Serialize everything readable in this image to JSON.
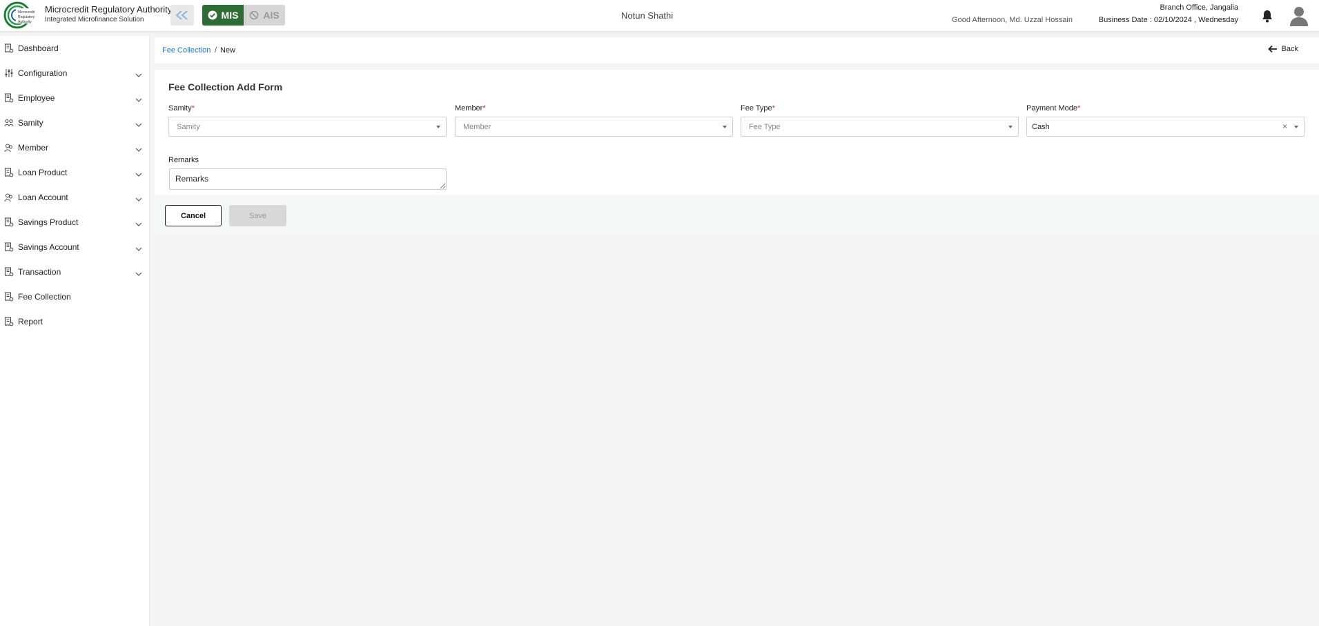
{
  "header": {
    "brand_title": "Microcredit Regulatory Authority",
    "brand_subtitle": "Integrated Microfinance Solution",
    "logo_text": "Microcredit Regulatory Authority",
    "mode_mis": "MIS",
    "mode_ais": "AIS",
    "org_name": "Notun Shathi",
    "greeting": "Good Afternoon, Md. Uzzal Hossain",
    "branch": "Branch Office, Jangalia",
    "business_date": "Business Date : 02/10/2024 , Wednesday"
  },
  "sidebar": {
    "items": [
      {
        "label": "Dashboard",
        "icon": "document-icon",
        "has_children": false
      },
      {
        "label": "Configuration",
        "icon": "sliders-icon",
        "has_children": true
      },
      {
        "label": "Employee",
        "icon": "document-icon",
        "has_children": true
      },
      {
        "label": "Samity",
        "icon": "group-icon",
        "has_children": true
      },
      {
        "label": "Member",
        "icon": "users-icon",
        "has_children": true
      },
      {
        "label": "Loan Product",
        "icon": "document-icon",
        "has_children": true
      },
      {
        "label": "Loan Account",
        "icon": "users-icon",
        "has_children": true
      },
      {
        "label": "Savings Product",
        "icon": "document-icon",
        "has_children": true
      },
      {
        "label": "Savings Account",
        "icon": "document-icon",
        "has_children": true
      },
      {
        "label": "Transaction",
        "icon": "document-icon",
        "has_children": true
      },
      {
        "label": "Fee Collection",
        "icon": "document-icon",
        "has_children": false
      },
      {
        "label": "Report",
        "icon": "document-icon",
        "has_children": false
      }
    ]
  },
  "breadcrumb": {
    "link": "Fee Collection",
    "separator": "/",
    "current": "New",
    "back_label": "Back"
  },
  "form": {
    "title": "Fee Collection Add Form",
    "samity": {
      "label": "Samity",
      "required_mark": "*",
      "placeholder": "Samity"
    },
    "member": {
      "label": "Member",
      "required_mark": "*",
      "placeholder": "Member"
    },
    "fee_type": {
      "label": "Fee Type",
      "required_mark": "*",
      "placeholder": "Fee Type"
    },
    "payment_mode": {
      "label": "Payment Mode",
      "required_mark": "*",
      "value": "Cash",
      "clear": "×"
    },
    "remarks": {
      "label": "Remarks",
      "placeholder": "Remarks"
    },
    "cancel_label": "Cancel",
    "save_label": "Save"
  },
  "colors": {
    "accent_green": "#2e6b35",
    "link_blue": "#1a73c9",
    "required_red": "#d32f2f"
  }
}
